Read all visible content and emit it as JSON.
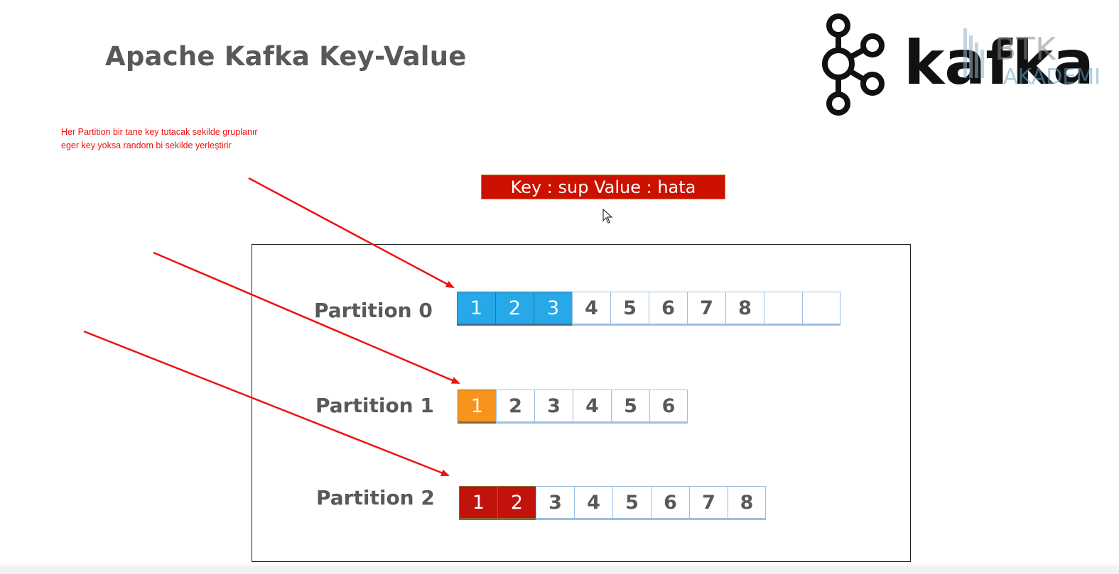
{
  "title": "Apache Kafka Key-Value",
  "note": {
    "line1": "Her Partition bir tane key tutacak sekilde gruplanır",
    "line2": "eger key yoksa random bi sekilde yerleştirir"
  },
  "keybox": {
    "text": "Key : sup Value : hata"
  },
  "logo": {
    "kafka_text": "kafka",
    "btk_text": "BTK",
    "akademi_text": "AKADEMI"
  },
  "colors": {
    "blue": "#27a8e8",
    "orange": "#f7941d",
    "red": "#c1120c",
    "arrow": "#ee1111"
  },
  "partitions": [
    {
      "label": "Partition 0",
      "cells": [
        {
          "text": "1",
          "fill": "blue"
        },
        {
          "text": "2",
          "fill": "blue"
        },
        {
          "text": "3",
          "fill": "blue"
        },
        {
          "text": "4",
          "fill": ""
        },
        {
          "text": "5",
          "fill": ""
        },
        {
          "text": "6",
          "fill": ""
        },
        {
          "text": "7",
          "fill": ""
        },
        {
          "text": "8",
          "fill": ""
        },
        {
          "text": "",
          "fill": ""
        },
        {
          "text": "",
          "fill": ""
        }
      ]
    },
    {
      "label": "Partition 1",
      "cells": [
        {
          "text": "1",
          "fill": "orange"
        },
        {
          "text": "2",
          "fill": ""
        },
        {
          "text": "3",
          "fill": ""
        },
        {
          "text": "4",
          "fill": ""
        },
        {
          "text": "5",
          "fill": ""
        },
        {
          "text": "6",
          "fill": ""
        }
      ]
    },
    {
      "label": "Partition 2",
      "cells": [
        {
          "text": "1",
          "fill": "red"
        },
        {
          "text": "2",
          "fill": "red"
        },
        {
          "text": "3",
          "fill": ""
        },
        {
          "text": "4",
          "fill": ""
        },
        {
          "text": "5",
          "fill": ""
        },
        {
          "text": "6",
          "fill": ""
        },
        {
          "text": "7",
          "fill": ""
        },
        {
          "text": "8",
          "fill": ""
        }
      ]
    }
  ]
}
